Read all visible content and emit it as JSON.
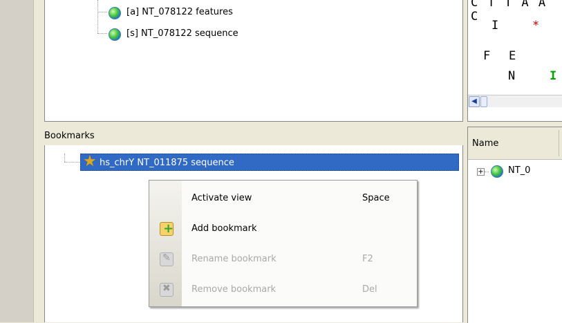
{
  "project_tree": {
    "items": [
      {
        "label": "[a] NT_078122 features",
        "icon": "globe-icon"
      },
      {
        "label": "[s] NT_078122 sequence",
        "icon": "globe-icon"
      }
    ]
  },
  "sequence_view": {
    "rows": [
      {
        "text": "C T T A A C",
        "row": 0
      },
      {
        "text": "I",
        "row": 1
      },
      {
        "text": "*",
        "row": 1,
        "color": "#c00000"
      },
      {
        "text": "F",
        "row": 2
      },
      {
        "text": "E",
        "row": 2
      },
      {
        "text": "N",
        "row": 3
      },
      {
        "text": "I",
        "row": 3,
        "color": "#00a000"
      }
    ]
  },
  "bookmarks": {
    "header": "Bookmarks",
    "items": [
      {
        "label": "hs_chrY NT_011875 sequence",
        "icon": "star-icon",
        "selected": true
      }
    ]
  },
  "objects_table": {
    "column_name": "Name",
    "rows": [
      {
        "label": "NT_0",
        "icon": "globe-icon"
      }
    ]
  },
  "context_menu": {
    "items": [
      {
        "label": "Activate view",
        "shortcut": "Space",
        "enabled": true,
        "icon": ""
      },
      {
        "label": "Add bookmark",
        "shortcut": "",
        "enabled": true,
        "icon": "add-bookmark-icon"
      },
      {
        "label": "Rename bookmark",
        "shortcut": "F2",
        "enabled": false,
        "icon": "rename-bookmark-icon"
      },
      {
        "label": "Remove bookmark",
        "shortcut": "Del",
        "enabled": false,
        "icon": "remove-bookmark-icon"
      }
    ]
  },
  "colors": {
    "selection": "#316ac5",
    "window_bg": "#ece9d8"
  }
}
